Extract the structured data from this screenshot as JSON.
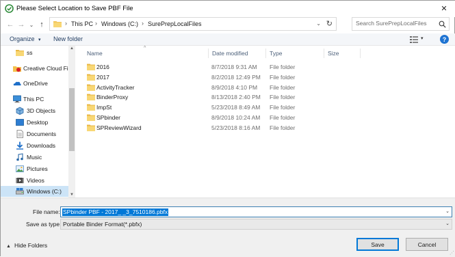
{
  "window": {
    "title": "Please Select Location to Save PBF File",
    "close_glyph": "✕"
  },
  "address": {
    "back_glyph": "←",
    "forward_glyph": "→",
    "up_history_glyph": "⌄",
    "up_glyph": "↑",
    "breadcrumbs": [
      "This PC",
      "Windows (C:)",
      "SurePrepLocalFiles"
    ],
    "separator": "›",
    "dropdown_glyph": "⌄",
    "refresh_glyph": "↻"
  },
  "search": {
    "placeholder": "Search SurePrepLocalFiles"
  },
  "commandbar": {
    "organize_label": "Organize",
    "organize_caret": "▾",
    "new_folder_label": "New folder",
    "view_caret": "▾",
    "help_glyph": "?"
  },
  "nav": {
    "scroll_up": "▲",
    "scroll_down": "▼",
    "items": [
      {
        "label": "ss",
        "icon": "folder-icon"
      },
      {
        "label": "Creative Cloud Fil",
        "icon": "creative-cloud-icon"
      },
      {
        "label": "OneDrive",
        "icon": "onedrive-icon"
      },
      {
        "label": "This PC",
        "icon": "computer-icon"
      },
      {
        "label": "3D Objects",
        "icon": "3d-objects-icon"
      },
      {
        "label": "Desktop",
        "icon": "desktop-icon"
      },
      {
        "label": "Documents",
        "icon": "documents-icon"
      },
      {
        "label": "Downloads",
        "icon": "downloads-icon"
      },
      {
        "label": "Music",
        "icon": "music-icon"
      },
      {
        "label": "Pictures",
        "icon": "pictures-icon"
      },
      {
        "label": "Videos",
        "icon": "videos-icon"
      },
      {
        "label": "Windows (C:)",
        "icon": "drive-icon"
      }
    ]
  },
  "filelist": {
    "sort_caret": "^",
    "columns": [
      "Name",
      "Date modified",
      "Type",
      "Size"
    ],
    "rows": [
      {
        "name": "2016",
        "date": "8/7/2018 9:31 AM",
        "type": "File folder"
      },
      {
        "name": "2017",
        "date": "8/2/2018 12:49 PM",
        "type": "File folder"
      },
      {
        "name": "ActivityTracker",
        "date": "8/9/2018 4:10 PM",
        "type": "File folder"
      },
      {
        "name": "BinderProxy",
        "date": "8/13/2018 2:40 PM",
        "type": "File folder"
      },
      {
        "name": "ImpSt",
        "date": "5/23/2018 8:49 AM",
        "type": "File folder"
      },
      {
        "name": "SPbinder",
        "date": "8/9/2018 10:24 AM",
        "type": "File folder"
      },
      {
        "name": "SPReviewWizard",
        "date": "5/23/2018 8:16 AM",
        "type": "File folder"
      }
    ]
  },
  "fields": {
    "file_name_label": "File name:",
    "file_name_value": "SPbinder PBF - 2017_ _3_7510186.pbfx",
    "save_type_label": "Save as type:",
    "save_type_value": "Portable Binder Format(*.pbfx)",
    "dropdown_caret": "⌄"
  },
  "footer": {
    "hide_folders_caret": "▲",
    "hide_folders_label": "Hide Folders",
    "save_label": "Save",
    "cancel_label": "Cancel",
    "grip_glyph": "⋰"
  },
  "colors": {
    "accent": "#0078d7",
    "folder": "#f2c55c",
    "selection": "#cce4f7"
  }
}
